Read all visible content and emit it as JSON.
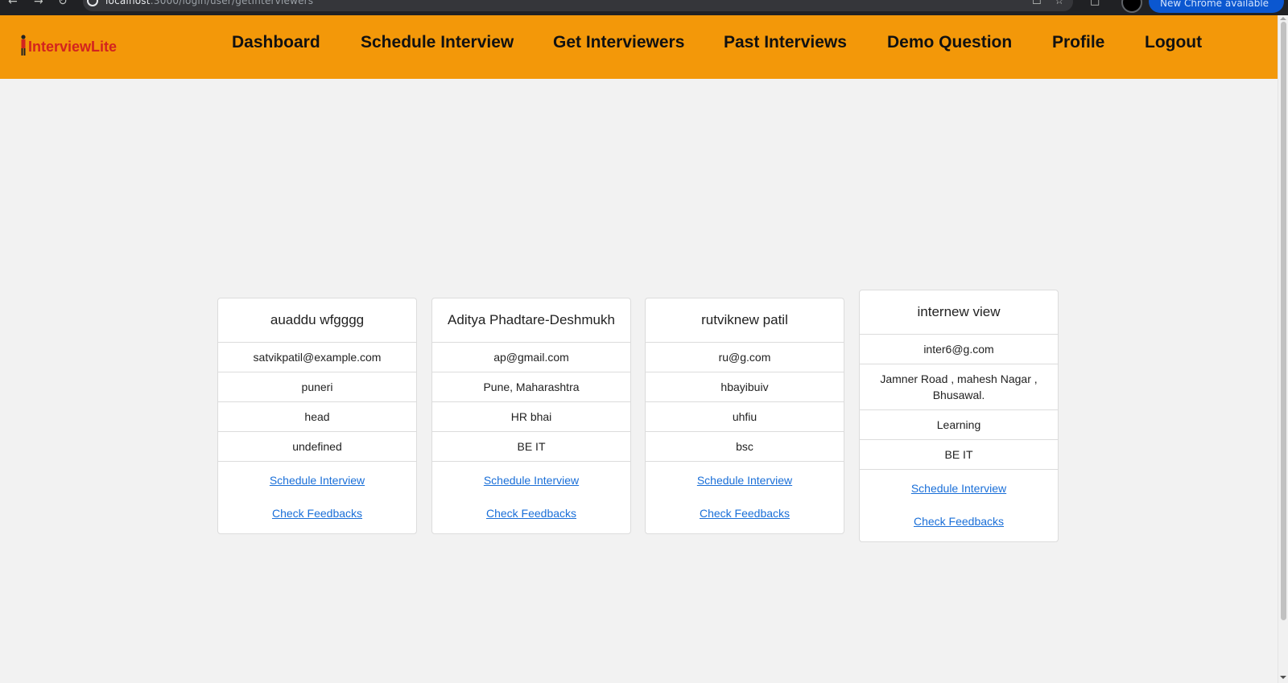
{
  "browser": {
    "url_host": "localhost",
    "url_rest": ":3000/login/user/getInterviewers",
    "update_label": "New Chrome available"
  },
  "app": {
    "logo_text": "InterviewLite",
    "colors": {
      "navbar": "#f39809",
      "logo": "#d3231f",
      "link": "#1a6fd8"
    }
  },
  "nav": {
    "dashboard": "Dashboard",
    "schedule": "Schedule Interview",
    "interviewers": "Get Interviewers",
    "past": "Past Interviews",
    "demo": "Demo Question",
    "profile": "Profile",
    "logout": "Logout"
  },
  "interviewers": [
    {
      "name": "auaddu wfgggg",
      "email": "satvikpatil@example.com",
      "location": "puneri",
      "position": "head",
      "education": "undefined",
      "schedule_label": "Schedule Interview",
      "feedback_label": "Check Feedbacks"
    },
    {
      "name": "Aditya Phadtare-Deshmukh",
      "email": "ap@gmail.com",
      "location": "Pune, Maharashtra",
      "position": "HR bhai",
      "education": "BE IT",
      "schedule_label": "Schedule Interview",
      "feedback_label": "Check Feedbacks"
    },
    {
      "name": "rutviknew patil",
      "email": "ru@g.com",
      "location": "hbayibuiv",
      "position": "uhfiu",
      "education": "bsc",
      "schedule_label": "Schedule Interview",
      "feedback_label": "Check Feedbacks"
    },
    {
      "name": "internew view",
      "email": "inter6@g.com",
      "location": "Jamner Road , mahesh Nagar , Bhusawal.",
      "position": "Learning",
      "education": "BE IT",
      "schedule_label": "Schedule Interview",
      "feedback_label": "Check Feedbacks"
    }
  ]
}
